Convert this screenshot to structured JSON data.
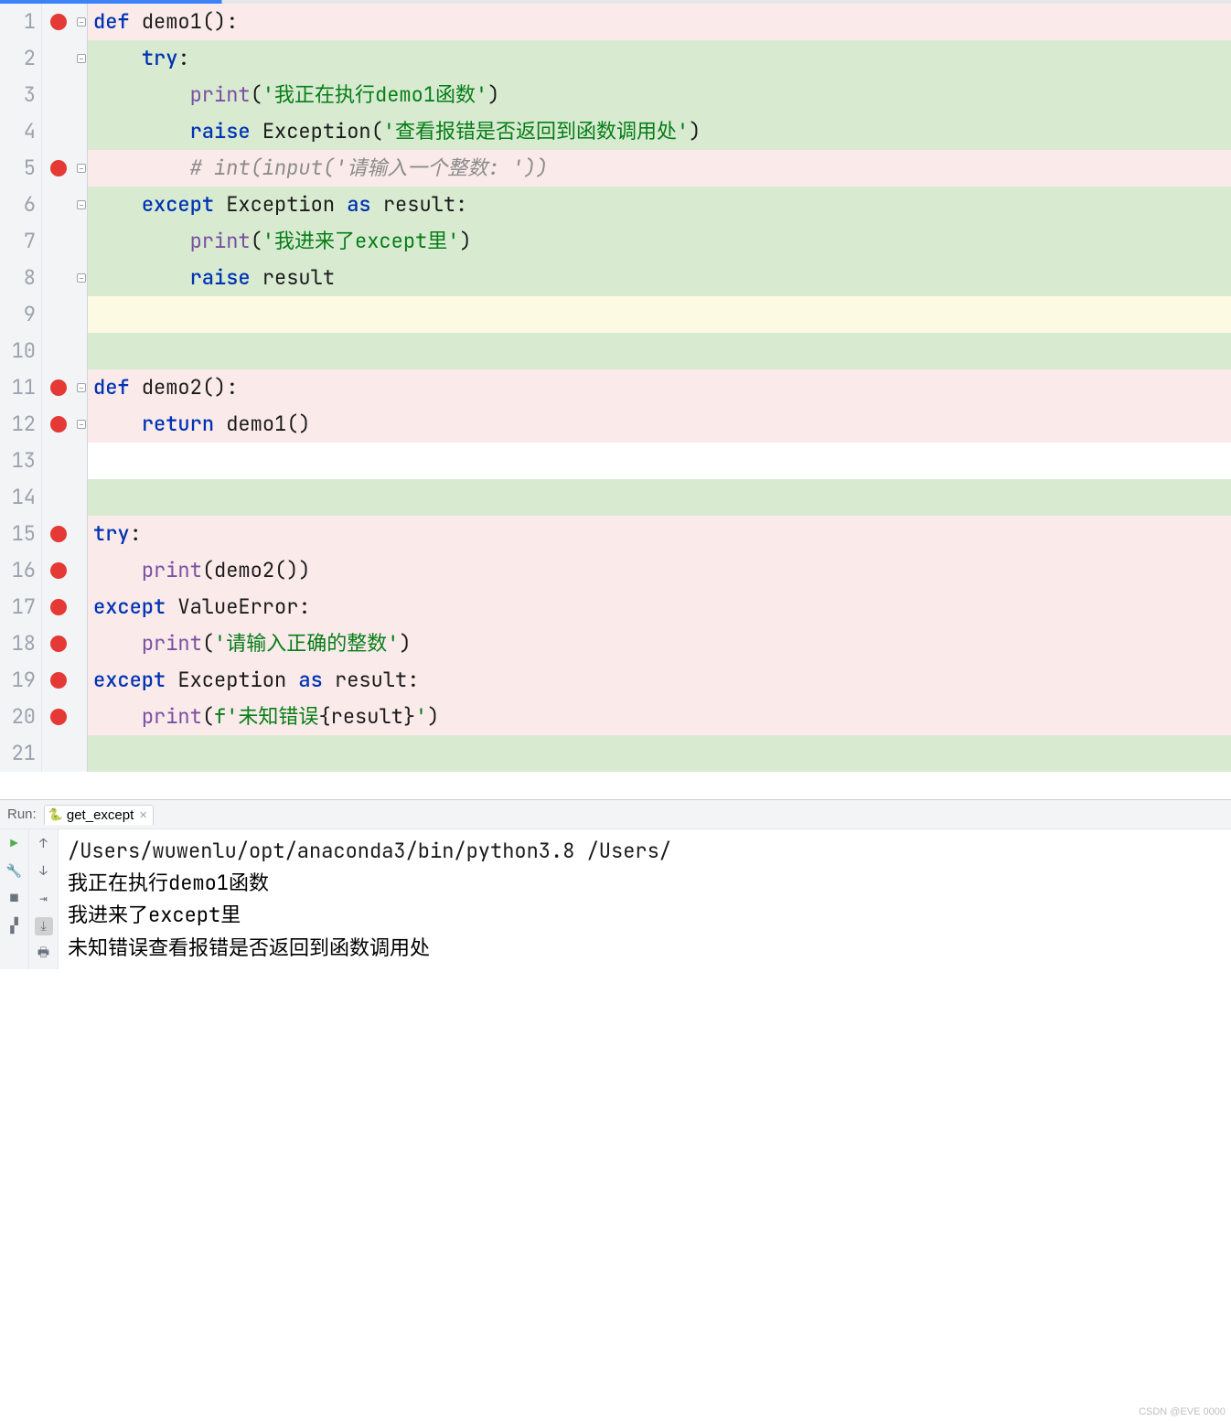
{
  "code": {
    "lines": [
      {
        "n": "1",
        "bp": true,
        "fold": true,
        "bg": "pink",
        "segs": [
          {
            "t": "def ",
            "c": "kw"
          },
          {
            "t": "demo1():",
            "c": "fn"
          }
        ]
      },
      {
        "n": "2",
        "bp": false,
        "fold": true,
        "bg": "green",
        "segs": [
          {
            "t": "    ",
            "c": ""
          },
          {
            "t": "try",
            "c": "kw"
          },
          {
            "t": ":",
            "c": "pn"
          }
        ]
      },
      {
        "n": "3",
        "bp": false,
        "fold": false,
        "bg": "green",
        "segs": [
          {
            "t": "        ",
            "c": ""
          },
          {
            "t": "print",
            "c": "bi"
          },
          {
            "t": "(",
            "c": "pn"
          },
          {
            "t": "'我正在执行demo1函数'",
            "c": "str"
          },
          {
            "t": ")",
            "c": "pn"
          }
        ]
      },
      {
        "n": "4",
        "bp": false,
        "fold": false,
        "bg": "green",
        "segs": [
          {
            "t": "        ",
            "c": ""
          },
          {
            "t": "raise ",
            "c": "kw"
          },
          {
            "t": "Exception(",
            "c": "fn"
          },
          {
            "t": "'查看报错是否返回到函数调用处'",
            "c": "str"
          },
          {
            "t": ")",
            "c": "pn"
          }
        ]
      },
      {
        "n": "5",
        "bp": true,
        "fold": true,
        "bg": "pink",
        "segs": [
          {
            "t": "        ",
            "c": ""
          },
          {
            "t": "# int(input('请输入一个整数: '))",
            "c": "cm"
          }
        ]
      },
      {
        "n": "6",
        "bp": false,
        "fold": true,
        "bg": "green",
        "segs": [
          {
            "t": "    ",
            "c": ""
          },
          {
            "t": "except ",
            "c": "kw"
          },
          {
            "t": "Exception ",
            "c": "fn"
          },
          {
            "t": "as ",
            "c": "kw"
          },
          {
            "t": "result:",
            "c": "fn"
          }
        ]
      },
      {
        "n": "7",
        "bp": false,
        "fold": false,
        "bg": "green",
        "segs": [
          {
            "t": "        ",
            "c": ""
          },
          {
            "t": "print",
            "c": "bi"
          },
          {
            "t": "(",
            "c": "pn"
          },
          {
            "t": "'我进来了except里'",
            "c": "str"
          },
          {
            "t": ")",
            "c": "pn"
          }
        ]
      },
      {
        "n": "8",
        "bp": false,
        "fold": true,
        "bg": "green",
        "segs": [
          {
            "t": "        ",
            "c": ""
          },
          {
            "t": "raise ",
            "c": "kw"
          },
          {
            "t": "result",
            "c": "fn"
          }
        ]
      },
      {
        "n": "9",
        "bp": false,
        "fold": false,
        "bg": "yellow",
        "segs": [
          {
            "t": "",
            "c": ""
          }
        ]
      },
      {
        "n": "10",
        "bp": false,
        "fold": false,
        "bg": "green",
        "segs": [
          {
            "t": "",
            "c": ""
          }
        ]
      },
      {
        "n": "11",
        "bp": true,
        "fold": true,
        "bg": "pink",
        "segs": [
          {
            "t": "def ",
            "c": "kw"
          },
          {
            "t": "demo2():",
            "c": "fn"
          }
        ]
      },
      {
        "n": "12",
        "bp": true,
        "fold": true,
        "bg": "pink",
        "segs": [
          {
            "t": "    ",
            "c": ""
          },
          {
            "t": "return ",
            "c": "kw"
          },
          {
            "t": "demo1()",
            "c": "fn"
          }
        ]
      },
      {
        "n": "13",
        "bp": false,
        "fold": false,
        "bg": "white",
        "segs": [
          {
            "t": "",
            "c": ""
          }
        ]
      },
      {
        "n": "14",
        "bp": false,
        "fold": false,
        "bg": "green",
        "segs": [
          {
            "t": "",
            "c": ""
          }
        ]
      },
      {
        "n": "15",
        "bp": true,
        "fold": false,
        "bg": "pink",
        "segs": [
          {
            "t": "try",
            "c": "kw"
          },
          {
            "t": ":",
            "c": "pn"
          }
        ]
      },
      {
        "n": "16",
        "bp": true,
        "fold": false,
        "bg": "pink",
        "segs": [
          {
            "t": "    ",
            "c": ""
          },
          {
            "t": "print",
            "c": "bi"
          },
          {
            "t": "(demo2())",
            "c": "fn"
          }
        ]
      },
      {
        "n": "17",
        "bp": true,
        "fold": false,
        "bg": "pink",
        "segs": [
          {
            "t": "except ",
            "c": "kw"
          },
          {
            "t": "ValueError:",
            "c": "fn"
          }
        ]
      },
      {
        "n": "18",
        "bp": true,
        "fold": false,
        "bg": "pink",
        "segs": [
          {
            "t": "    ",
            "c": ""
          },
          {
            "t": "print",
            "c": "bi"
          },
          {
            "t": "(",
            "c": "pn"
          },
          {
            "t": "'请输入正确的整数'",
            "c": "str"
          },
          {
            "t": ")",
            "c": "pn"
          }
        ]
      },
      {
        "n": "19",
        "bp": true,
        "fold": false,
        "bg": "pink",
        "segs": [
          {
            "t": "except ",
            "c": "kw"
          },
          {
            "t": "Exception ",
            "c": "fn"
          },
          {
            "t": "as ",
            "c": "kw"
          },
          {
            "t": "result:",
            "c": "fn"
          }
        ]
      },
      {
        "n": "20",
        "bp": true,
        "fold": false,
        "bg": "pink",
        "segs": [
          {
            "t": "    ",
            "c": ""
          },
          {
            "t": "print",
            "c": "bi"
          },
          {
            "t": "(",
            "c": "pn"
          },
          {
            "t": "f'未知错误",
            "c": "str"
          },
          {
            "t": "{result}",
            "c": "fn"
          },
          {
            "t": "'",
            "c": "str"
          },
          {
            "t": ")",
            "c": "pn"
          }
        ]
      },
      {
        "n": "21",
        "bp": false,
        "fold": false,
        "bg": "green",
        "segs": [
          {
            "t": "",
            "c": ""
          }
        ]
      }
    ]
  },
  "run": {
    "label": "Run:",
    "tab_name": "get_except",
    "close_glyph": "×",
    "output": [
      "/Users/wuwenlu/opt/anaconda3/bin/python3.8 /Users/",
      "我正在执行demo1函数",
      "我进来了except里",
      "未知错误查看报错是否返回到函数调用处"
    ]
  },
  "icons": {
    "play": "▶",
    "wrench": "🔧",
    "stop": "■",
    "layout": "▞",
    "up": "↑",
    "down": "↓",
    "wrap": "⇥",
    "scroll": "⤓",
    "print": "🖶"
  },
  "watermark": "CSDN @EVE 0000"
}
